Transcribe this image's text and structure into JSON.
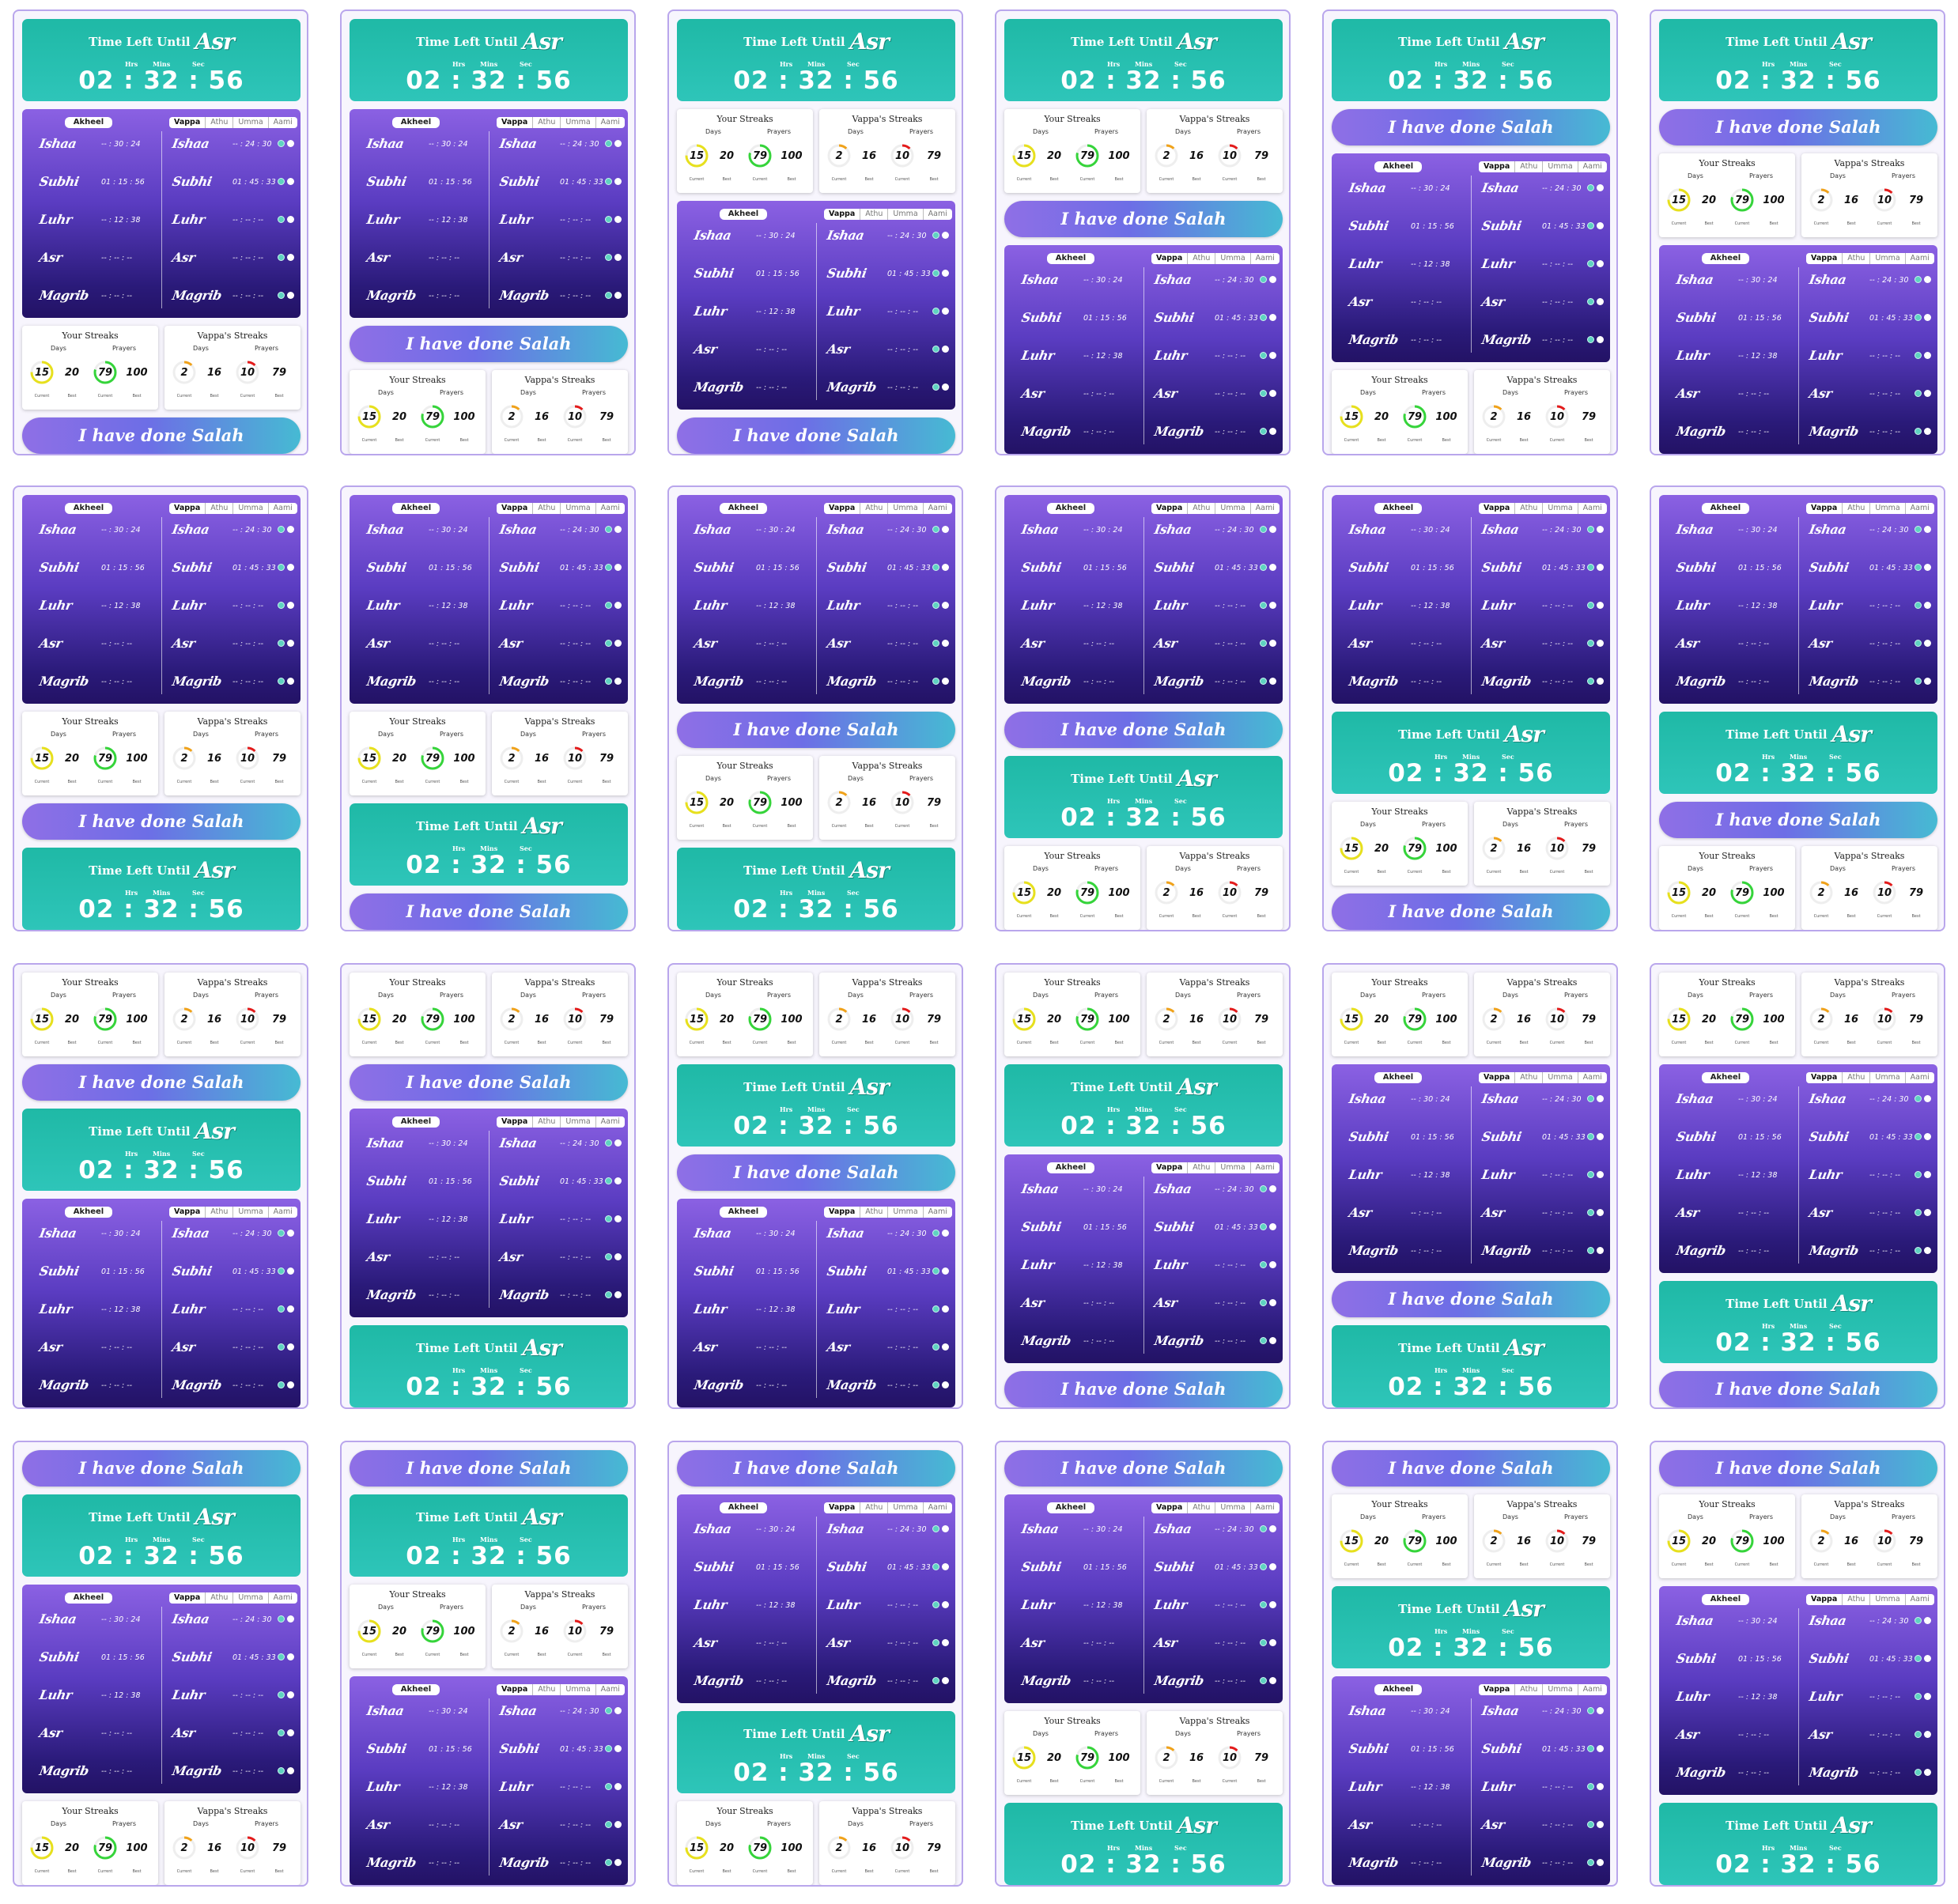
{
  "timer": {
    "title": "Time Left Until",
    "prayer": "Asr",
    "hrs_label": "Hrs",
    "mins_label": "Mins",
    "sec_label": "Sec",
    "countdown": "02 : 32 : 56"
  },
  "done_button": "I have done Salah",
  "streaks": {
    "cards": [
      {
        "title": "Your Streaks",
        "days_label": "Days",
        "prayers_label": "Prayers",
        "days_current": "15",
        "days_best": "20",
        "prayers_current": "79",
        "prayers_best": "100",
        "current_label": "Current",
        "best_label": "Best"
      },
      {
        "title": "Vappa's Streaks",
        "days_label": "Days",
        "prayers_label": "Prayers",
        "days_current": "2",
        "days_best": "16",
        "prayers_current": "10",
        "prayers_best": "79",
        "current_label": "Current",
        "best_label": "Best"
      }
    ],
    "ring_levels": {
      "your_days": 0.75,
      "your_prayers": 0.79,
      "vappa_days": 0.125,
      "vappa_prayers": 0.127
    },
    "ring_colors": {
      "your_days": "#e7e01d",
      "your_prayers": "#35d43a",
      "vappa_days": "#f0a21a",
      "vappa_prayers": "#e31b1b"
    }
  },
  "panel": {
    "left_user": "Akheel",
    "tabs": [
      "Vappa",
      "Athu",
      "Umma",
      "Aami"
    ],
    "prayers": [
      "Ishaa",
      "Subhi",
      "Luhr",
      "Asr",
      "Magrib"
    ],
    "left_times": [
      "-- : 30 : 24",
      "01 : 15 : 56",
      "-- : 12 : 38",
      "-- : -- : --",
      "-- : -- : --"
    ],
    "right_times": [
      "-- : 24 : 30",
      "01 : 45 : 33",
      "-- : -- : --",
      "-- : -- : --",
      "-- : -- : --"
    ]
  },
  "layouts": [
    [
      "timer",
      "panel",
      "streaks",
      "done"
    ],
    [
      "timer",
      "panel",
      "done",
      "streaks"
    ],
    [
      "timer",
      "streaks",
      "panel",
      "done"
    ],
    [
      "timer",
      "streaks",
      "done",
      "panel"
    ],
    [
      "timer",
      "done",
      "panel",
      "streaks"
    ],
    [
      "timer",
      "done",
      "streaks",
      "panel"
    ],
    [
      "panel",
      "streaks",
      "done",
      "timer"
    ],
    [
      "panel",
      "streaks",
      "timer",
      "done"
    ],
    [
      "panel",
      "done",
      "streaks",
      "timer"
    ],
    [
      "panel",
      "done",
      "timer",
      "streaks"
    ],
    [
      "panel",
      "timer",
      "streaks",
      "done"
    ],
    [
      "panel",
      "timer",
      "done",
      "streaks"
    ],
    [
      "streaks",
      "done",
      "timer",
      "panel"
    ],
    [
      "streaks",
      "done",
      "panel",
      "timer"
    ],
    [
      "streaks",
      "timer",
      "done",
      "panel"
    ],
    [
      "streaks",
      "timer",
      "panel",
      "done"
    ],
    [
      "streaks",
      "panel",
      "done",
      "timer"
    ],
    [
      "streaks",
      "panel",
      "timer",
      "done"
    ],
    [
      "done",
      "timer",
      "panel",
      "streaks"
    ],
    [
      "done",
      "timer",
      "streaks",
      "panel"
    ],
    [
      "done",
      "panel",
      "timer",
      "streaks"
    ],
    [
      "done",
      "panel",
      "streaks",
      "timer"
    ],
    [
      "done",
      "streaks",
      "timer",
      "panel"
    ],
    [
      "done",
      "streaks",
      "panel",
      "timer"
    ]
  ]
}
